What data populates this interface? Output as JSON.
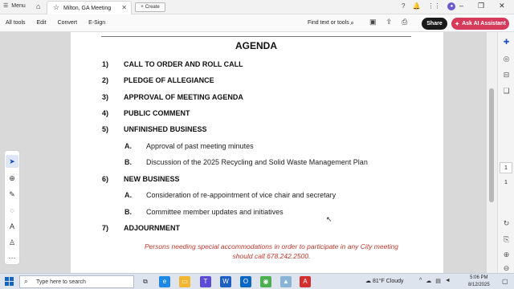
{
  "browser": {
    "menu_label": "Menu",
    "tab_title": "Milton, GA Meeting",
    "create_label": "Create"
  },
  "toolbar": {
    "menus": [
      "All tools",
      "Edit",
      "Convert",
      "E-Sign"
    ],
    "find_label": "Find text or tools",
    "share_label": "Share",
    "ai_label": "Ask AI Assistant",
    "ai_color": "#d63a5a"
  },
  "document": {
    "heading": "AGENDA",
    "items": [
      {
        "num": "1)",
        "label": "CALL TO ORDER AND ROLL CALL"
      },
      {
        "num": "2)",
        "label": "PLEDGE OF ALLEGIANCE"
      },
      {
        "num": "3)",
        "label": "APPROVAL OF MEETING AGENDA"
      },
      {
        "num": "4)",
        "label": "PUBLIC COMMENT"
      },
      {
        "num": "5)",
        "label": "UNFINISHED BUSINESS"
      },
      {
        "num": "6)",
        "label": "NEW BUSINESS"
      },
      {
        "num": "7)",
        "label": "ADJOURNMENT"
      }
    ],
    "sub_5": [
      {
        "letter": "A.",
        "text": "Approval of past meeting minutes"
      },
      {
        "letter": "B.",
        "text": "Discussion of the 2025 Recycling and Solid Waste Management Plan"
      }
    ],
    "sub_6": [
      {
        "letter": "A.",
        "text": "Consideration of re-appointment of vice chair and secretary"
      },
      {
        "letter": "B.",
        "text": "Committee member updates and initiatives"
      }
    ],
    "notice_line1": "Persons needing special accommodations in order to participate in any City meeting",
    "notice_line2": "should call 678.242.2500.",
    "notice_color": "#c0392b"
  },
  "page_nav": {
    "current_page": "1",
    "total_pages": "1"
  },
  "taskbar": {
    "search_placeholder": "Type here to search",
    "weather": "81°F  Cloudy",
    "time": "5:06 PM",
    "date": "8/12/2025"
  }
}
